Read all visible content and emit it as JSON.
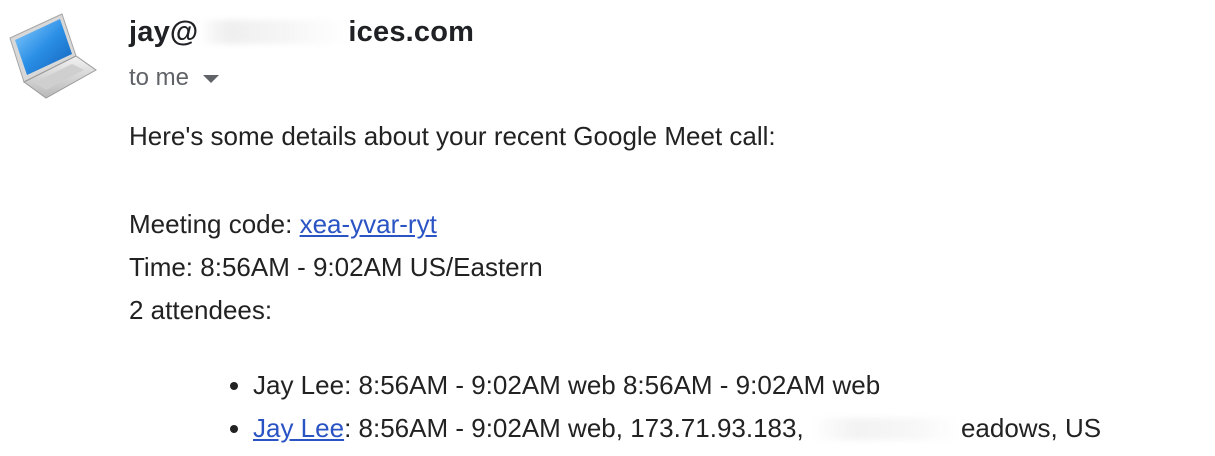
{
  "email": {
    "sender": {
      "prefix": "jay@",
      "suffix": "ices.com",
      "avatar_icon": "laptop-icon"
    },
    "recipient_label": "to me",
    "intro": "Here's some details about your recent Google Meet call:",
    "meeting_code_label": "Meeting code: ",
    "meeting_code": "xea-yvar-ryt",
    "time_line": "Time: 8:56AM - 9:02AM US/Eastern",
    "attendees_line": "2 attendees:",
    "attendees": [
      {
        "text": "Jay Lee: 8:56AM - 9:02AM web 8:56AM - 9:02AM web"
      },
      {
        "name": "Jay Lee",
        "details": ": 8:56AM - 9:02AM web, 173.71.93.183, ",
        "tail": "eadows, US"
      }
    ]
  },
  "colors": {
    "link": "#2a54c4",
    "text": "#222222",
    "secondary": "#5f6368"
  }
}
